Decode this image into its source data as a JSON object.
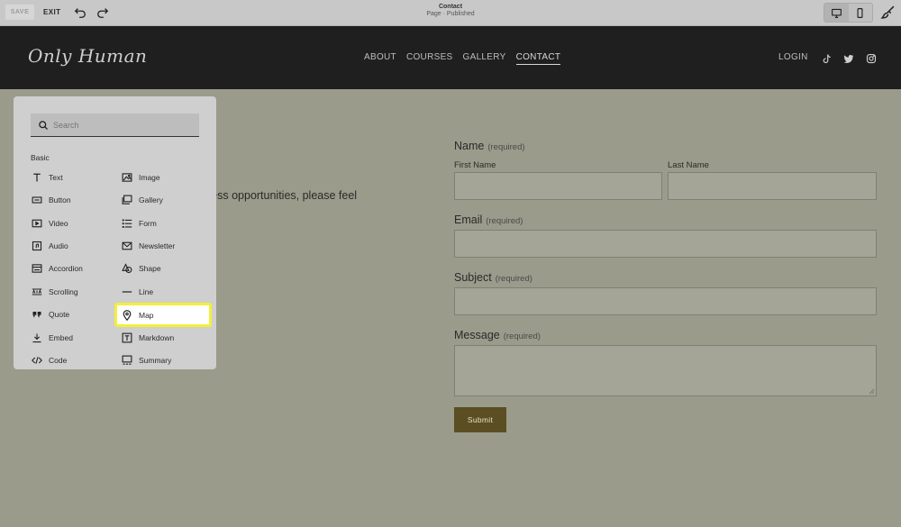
{
  "editor": {
    "save_label": "SAVE",
    "exit_label": "EXIT",
    "page_title": "Contact",
    "page_status": "Page · Published",
    "undo_icon": "undo-icon",
    "redo_icon": "redo-icon",
    "desktop_icon": "desktop-icon",
    "mobile_icon": "mobile-icon",
    "brush_icon": "paintbrush-icon"
  },
  "site": {
    "logo": "Only Human",
    "nav": [
      {
        "label": "ABOUT"
      },
      {
        "label": "COURSES"
      },
      {
        "label": "GALLERY"
      },
      {
        "label": "CONTACT",
        "active": true
      }
    ],
    "login_label": "LOGIN",
    "social": [
      "tiktok-icon",
      "twitter-icon",
      "instagram-icon"
    ]
  },
  "content": {
    "body_fragment": "ress opportunities, please feel"
  },
  "form": {
    "name_label": "Name",
    "name_req": "(required)",
    "first_name_label": "First Name",
    "last_name_label": "Last Name",
    "email_label": "Email",
    "email_req": "(required)",
    "subject_label": "Subject",
    "subject_req": "(required)",
    "message_label": "Message",
    "message_req": "(required)",
    "submit_label": "Submit",
    "submit_color": "#5a4e22"
  },
  "panel": {
    "search_placeholder": "Search",
    "section_title": "Basic",
    "highlight_color": "#f3ef3a",
    "left_items": [
      {
        "label": "Text",
        "icon": "text-icon"
      },
      {
        "label": "Button",
        "icon": "button-icon"
      },
      {
        "label": "Video",
        "icon": "video-icon"
      },
      {
        "label": "Audio",
        "icon": "audio-icon"
      },
      {
        "label": "Accordion",
        "icon": "accordion-icon"
      },
      {
        "label": "Scrolling",
        "icon": "scrolling-icon"
      },
      {
        "label": "Quote",
        "icon": "quote-icon"
      },
      {
        "label": "Embed",
        "icon": "embed-icon"
      },
      {
        "label": "Code",
        "icon": "code-icon"
      }
    ],
    "right_items": [
      {
        "label": "Image",
        "icon": "image-icon"
      },
      {
        "label": "Gallery",
        "icon": "gallery-icon"
      },
      {
        "label": "Form",
        "icon": "form-icon"
      },
      {
        "label": "Newsletter",
        "icon": "newsletter-icon"
      },
      {
        "label": "Shape",
        "icon": "shape-icon"
      },
      {
        "label": "Line",
        "icon": "line-icon"
      },
      {
        "label": "Map",
        "icon": "map-pin-icon",
        "highlighted": true
      },
      {
        "label": "Markdown",
        "icon": "markdown-icon"
      },
      {
        "label": "Summary",
        "icon": "summary-icon"
      }
    ]
  }
}
